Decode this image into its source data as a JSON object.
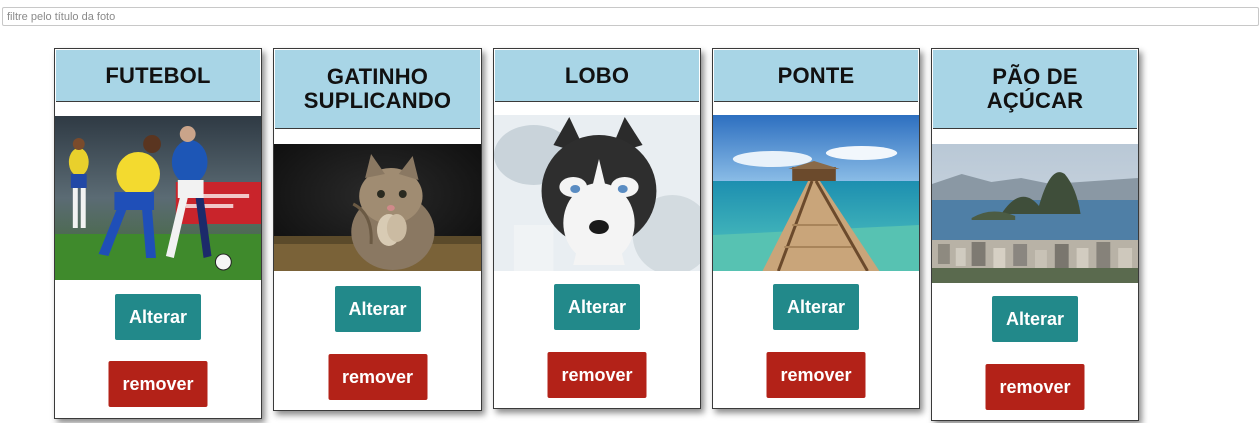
{
  "filter": {
    "placeholder": "filtre pelo título da foto",
    "value": ""
  },
  "buttons": {
    "alter_label": "Alterar",
    "remove_label": "remover"
  },
  "colors": {
    "header_bg": "#a8d5e6",
    "alter_bg": "#22898a",
    "remove_bg": "#b32218"
  },
  "photos": [
    {
      "title": "FUTEBOL",
      "image": "soccer-players-photo"
    },
    {
      "title": "GATINHO SUPLICANDO",
      "image": "begging-kitten-photo"
    },
    {
      "title": "LOBO",
      "image": "husky-wolf-photo"
    },
    {
      "title": "PONTE",
      "image": "pier-bridge-photo"
    },
    {
      "title": "PÃO DE AÇÚCAR",
      "image": "sugarloaf-mountain-photo"
    }
  ]
}
